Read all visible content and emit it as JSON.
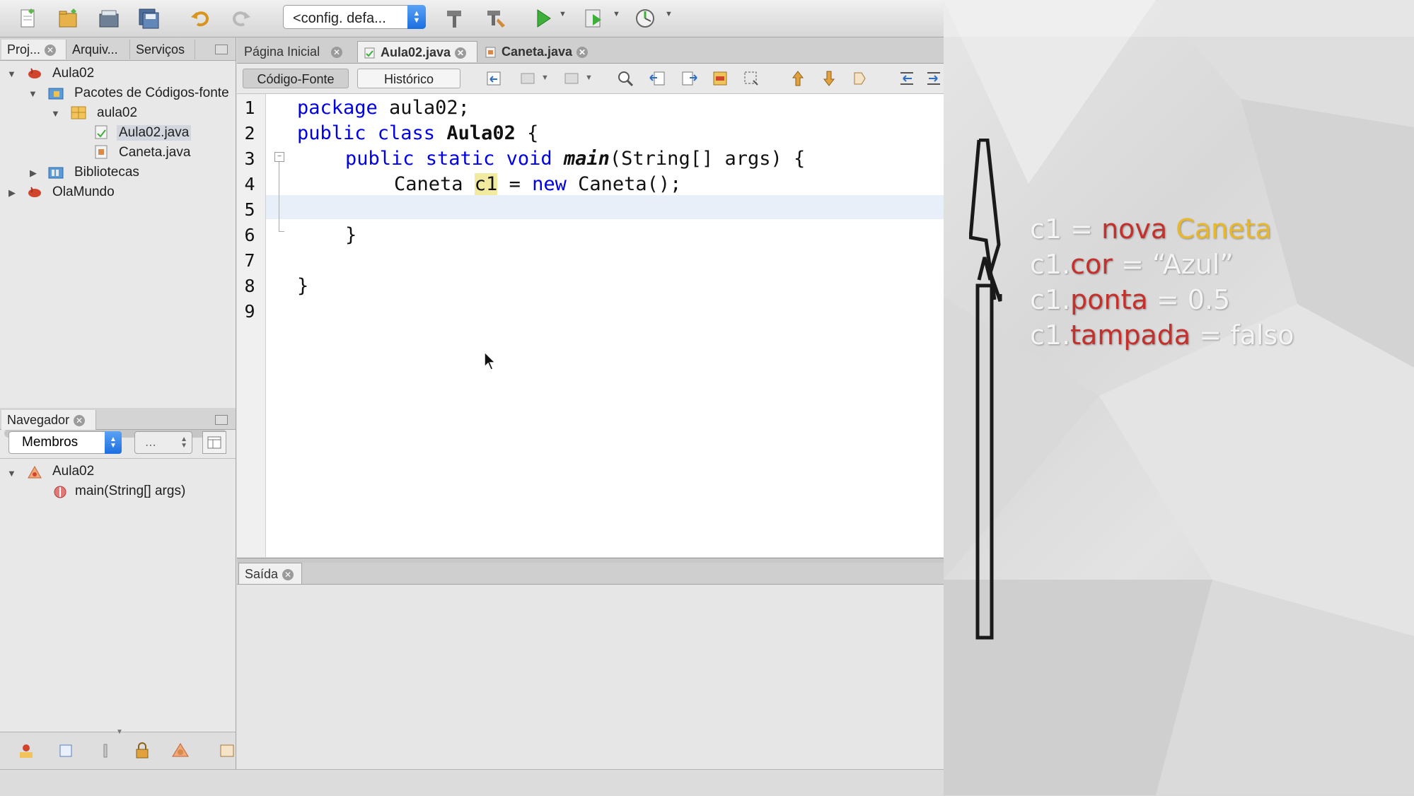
{
  "toolbar": {
    "config_label": "<config. defa...",
    "icons": [
      "new-file-icon",
      "new-project-icon",
      "open-project-icon",
      "save-all-icon",
      "undo-icon",
      "redo-icon",
      "build-icon",
      "clean-build-icon",
      "run-icon",
      "debug-icon",
      "profile-icon"
    ]
  },
  "projects_panel": {
    "tabs": [
      {
        "label": "Proj..."
      },
      {
        "label": "Arquiv..."
      },
      {
        "label": "Serviços"
      }
    ],
    "tree": [
      {
        "label": "Aula02"
      },
      {
        "label": "Pacotes de Códigos-fonte"
      },
      {
        "label": "aula02"
      },
      {
        "label": "Aula02.java"
      },
      {
        "label": "Caneta.java"
      },
      {
        "label": "Bibliotecas"
      },
      {
        "label": "OlaMundo"
      }
    ]
  },
  "navigator": {
    "title": "Navegador",
    "filter_value": "Membros",
    "second_value": "...",
    "tree": [
      {
        "label": "Aula02"
      },
      {
        "label": "main(String[] args)"
      }
    ]
  },
  "editor": {
    "tabs": [
      {
        "label": "Página Inicial"
      },
      {
        "label": "Aula02.java"
      },
      {
        "label": "Caneta.java"
      }
    ],
    "source_button": "Código-Fonte",
    "history_button": "Histórico",
    "line_numbers": [
      "1",
      "2",
      "3",
      "4",
      "5",
      "6",
      "7",
      "8",
      "9"
    ],
    "code": {
      "l1_kw": "package",
      "l1_rest": " aula02;",
      "l2_kw": "public class",
      "l2_name": "Aula02",
      "l2_rest": " {",
      "l3_kw": "public static void",
      "l3_name": "main",
      "l3_rest": "(String[] args) {",
      "l4_type": "Caneta ",
      "l4_var": "c1",
      "l4_eq": " = ",
      "l4_new": "new",
      "l4_rest": " Caneta();",
      "l6": "}",
      "l8": "}"
    }
  },
  "output": {
    "tab_label": "Saída"
  },
  "slide": {
    "line1": {
      "var": "c1 = ",
      "word1": "nova",
      "word2": "Caneta"
    },
    "line2": {
      "var": "c1.",
      "attr": "cor",
      "rest": " = “Azul”"
    },
    "line3": {
      "var": "c1.",
      "attr": "ponta",
      "rest": " = 0.5"
    },
    "line4": {
      "var": "c1.",
      "attr": "tampada",
      "rest": " = falso"
    },
    "colors": {
      "attribute": "#c4302b",
      "class": "#e8b82a",
      "text": "#f4f4f4"
    }
  }
}
